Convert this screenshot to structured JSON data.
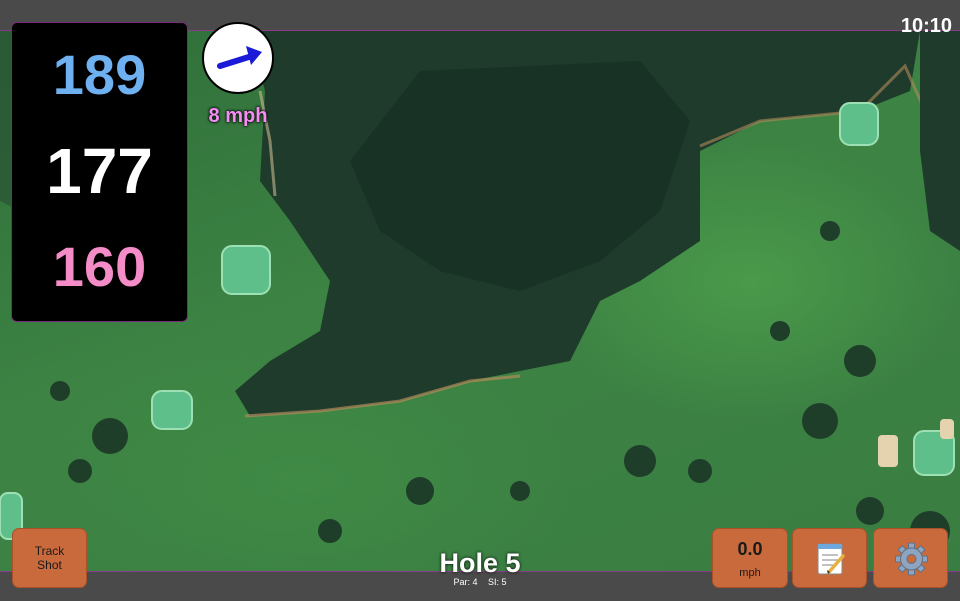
{
  "status": {
    "time": "10:10"
  },
  "distances": {
    "back": "189",
    "middle": "177",
    "front": "160"
  },
  "wind": {
    "speed_label": "8 mph",
    "direction_icon": "wind-arrow-icon"
  },
  "hole": {
    "title": "Hole 5",
    "par": "Par: 4",
    "stroke_index": "SI: 5"
  },
  "buttons": {
    "track_shot_line1": "Track",
    "track_shot_line2": "Shot",
    "wind_value": "0.0",
    "wind_unit": "mph",
    "notes_icon": "notepad-icon",
    "settings_icon": "gear-icon"
  },
  "colors": {
    "back_distance": "#6fb0f0",
    "middle_distance": "#ffffff",
    "front_distance": "#f48cc8",
    "button": "#c96a3c",
    "wind_text": "#f48cf4"
  }
}
